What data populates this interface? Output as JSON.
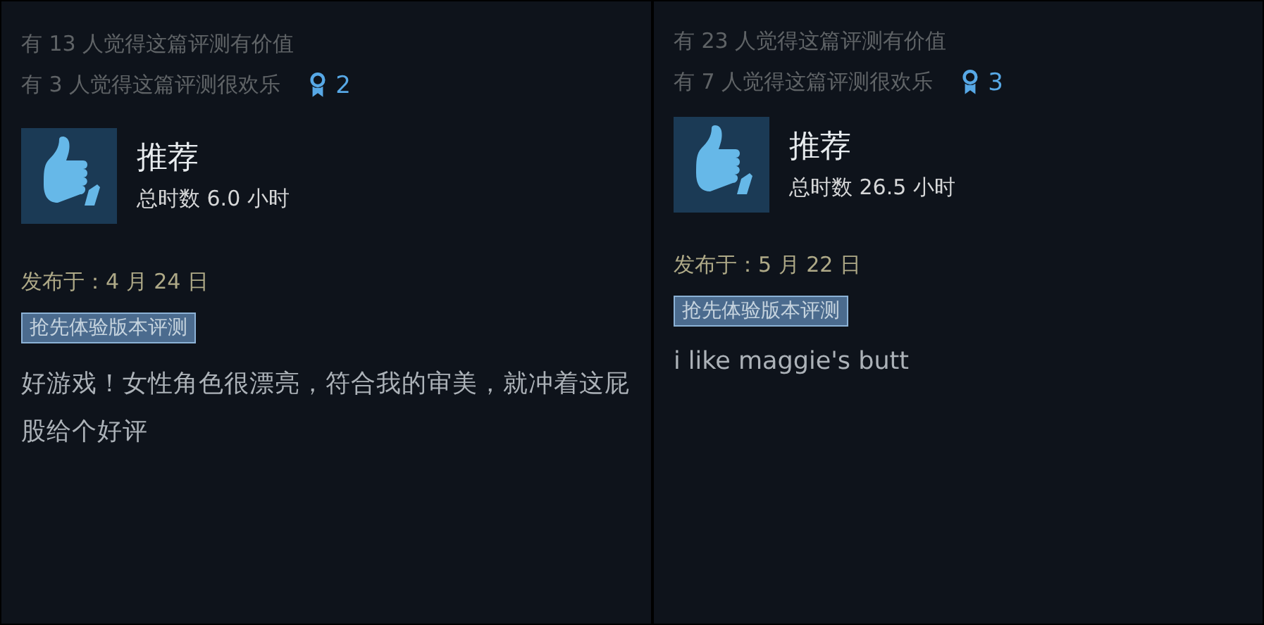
{
  "reviews": [
    {
      "helpful": "有 13 人觉得这篇评测有价值",
      "funny": "有 3 人觉得这篇评测很欢乐",
      "awards": "2",
      "recommended": true,
      "verdict": "推荐",
      "hours": "总时数 6.0 小时",
      "posted": "发布于：4 月 24 日",
      "tag": "抢先体验版本评测",
      "body": "好游戏！女性角色很漂亮，符合我的审美，就冲着这屁股给个好评"
    },
    {
      "helpful": "有 23 人觉得这篇评测有价值",
      "funny": "有 7 人觉得这篇评测很欢乐",
      "awards": "3",
      "recommended": true,
      "verdict": "推荐",
      "hours": "总时数 26.5 小时",
      "posted": "发布于：5 月 22 日",
      "tag": "抢先体验版本评测",
      "body": "i like maggie's butt"
    }
  ]
}
